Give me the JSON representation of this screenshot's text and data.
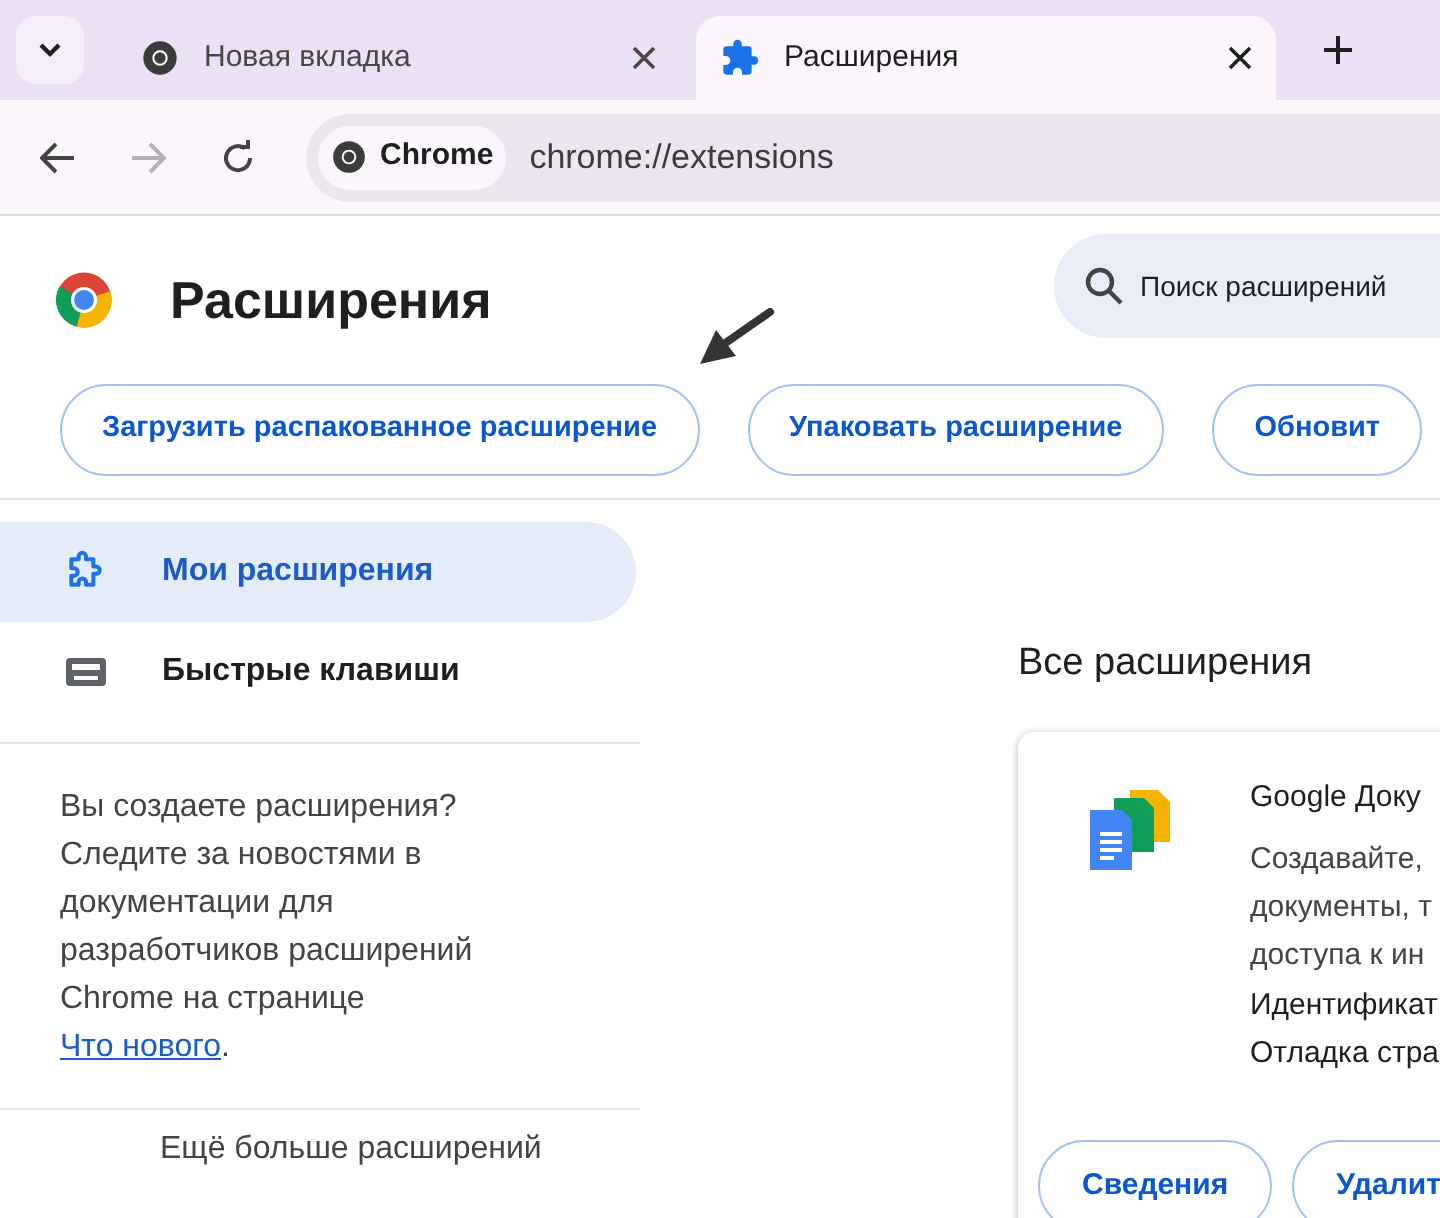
{
  "tabs": [
    {
      "title": "Новая вкладка",
      "kind": "chrome",
      "selected": false
    },
    {
      "title": "Расширения",
      "kind": "puzzle",
      "selected": true
    }
  ],
  "toolbar": {
    "forward_disabled": true,
    "site_chip": "Chrome",
    "url": "chrome://extensions"
  },
  "header": {
    "title": "Расширения",
    "search": {
      "placeholder": "Поиск расширений"
    }
  },
  "actions": [
    "Загрузить распакованное расширение",
    "Упаковать расширение",
    "Обновит"
  ],
  "sidebar": {
    "items": [
      {
        "label": "Мои расширения",
        "kind": "puzzle",
        "selected": true
      },
      {
        "label": "Быстрые клавиши",
        "kind": "keyboard",
        "selected": false
      }
    ],
    "note": {
      "text": "Вы создаете расширения? Следите за новостями в документации для разработчиков расширений Chrome на странице ",
      "link": "Что нового",
      "end": "."
    },
    "more": "Ещё больше расширений"
  },
  "main": {
    "heading": "Все расширения",
    "extension": {
      "name": "Google Доку",
      "description": [
        "Создавайте,",
        "документы, т",
        "доступа к ин"
      ],
      "id_line": "Идентификат",
      "debug_line": "Отладка стра",
      "buttons": [
        "Сведения",
        "Удалит"
      ]
    }
  }
}
